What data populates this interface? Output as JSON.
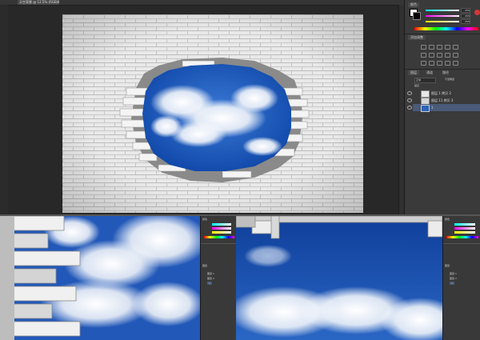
{
  "document": {
    "tab_title": "天空背景 @ 12.5% (RGB/8)"
  },
  "right_panel": {
    "color_tab": "颜色",
    "color_values": [
      "255",
      "255",
      "255"
    ],
    "adjustments_tab": "添加调整",
    "layers_tabs": [
      "图层",
      "通道",
      "路径"
    ],
    "blend_mode": "正常",
    "opacity_label": "不透明度",
    "lock_label": "锁定",
    "layers": [
      {
        "name": "图层 1 拷贝 2"
      },
      {
        "name": "图层 11 拷贝 3"
      },
      {
        "name": "1"
      }
    ]
  },
  "mini_panels": {
    "color_tab": "颜色",
    "layers_tab": "图层",
    "layers": [
      "图层 1",
      "图层 2",
      "1"
    ]
  },
  "colors": {
    "accent": "#2e63b8",
    "panel_bg": "#3a3a3a",
    "sky_blue": "#1e57b9"
  }
}
